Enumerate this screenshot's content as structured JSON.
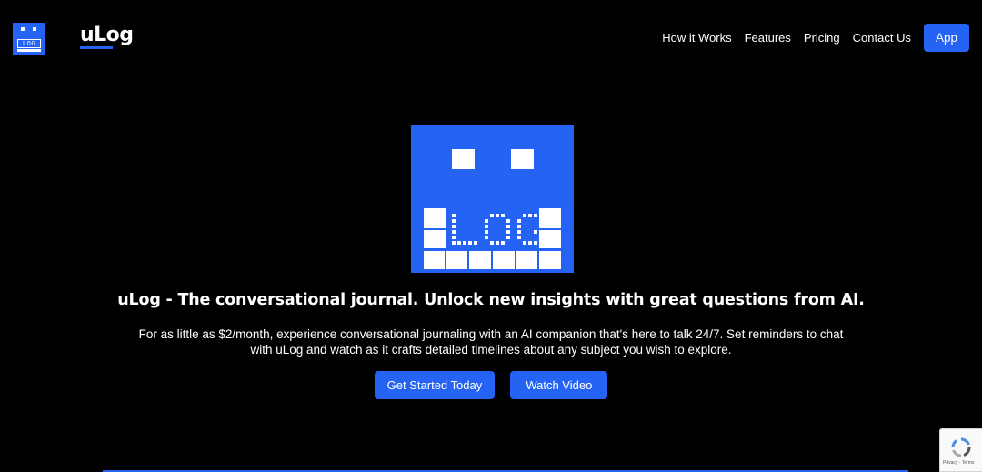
{
  "header": {
    "logo_text": "LOG",
    "brand": "uLog",
    "nav": [
      "How it Works",
      "Features",
      "Pricing",
      "Contact Us"
    ],
    "app_button": "App"
  },
  "hero": {
    "logo_text": "LOG",
    "headline": "uLog - The conversational journal. Unlock new insights with great questions from AI.",
    "subtext": "For as little as $2/month, experience conversational journaling with an AI companion that's here to talk 24/7. Set reminders to chat with uLog and watch as it crafts detailed timelines about any subject you wish to explore.",
    "primary_cta": "Get Started Today",
    "secondary_cta": "Watch Video"
  },
  "recaptcha": {
    "footer_text": "Privacy - Terms"
  },
  "colors": {
    "accent": "#2563f5",
    "background": "#000000"
  }
}
